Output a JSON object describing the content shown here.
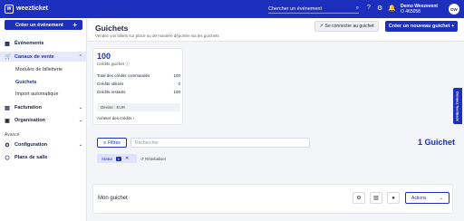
{
  "topbar": {
    "logo_text": "weezticket",
    "search_placeholder": "Chercher un événement",
    "user_name": "Demo Weezevent",
    "user_id": "O 465058",
    "avatar_initials": "DW"
  },
  "sidebar": {
    "create_label": "Créer un événement",
    "items": [
      {
        "label": "Événements"
      },
      {
        "label": "Canaux de vente"
      },
      {
        "label": "Modules de billetterie"
      },
      {
        "label": "Guichets"
      },
      {
        "label": "Import automatique"
      },
      {
        "label": "Facturation"
      },
      {
        "label": "Organisation"
      },
      {
        "label": "Avancé"
      },
      {
        "label": "Configuration"
      },
      {
        "label": "Plans de salle"
      }
    ]
  },
  "header": {
    "title": "Guichets",
    "subtitle": "Vendez vos billets sur place ou de manière déportée via les guichets",
    "connect_label": "Se connecter au guichet",
    "new_label": "Créer un nouveau guichet +"
  },
  "credits": {
    "count": "100",
    "label": "Crédits guichet",
    "rows": [
      {
        "label": "Total des crédits commandés",
        "value": "100"
      },
      {
        "label": "Crédits utilisés",
        "value": "0"
      },
      {
        "label": "Crédits restants",
        "value": "100"
      }
    ],
    "currency": "Devise : EUR",
    "buy_label": "Acheter des crédits"
  },
  "filters": {
    "filter_label": "Filtres",
    "search_placeholder": "Rechercher",
    "count_label": "1 Guichet",
    "chip_label": "Statut",
    "chip_count": "1",
    "reset_label": "Réinitialiser"
  },
  "ticket": {
    "name": "Mon guichet",
    "actions_label": "Actions"
  },
  "feedback_label": "Donnez feedback",
  "colors": {
    "brand": "#1c2fbd",
    "background": "#f4f5f9"
  }
}
